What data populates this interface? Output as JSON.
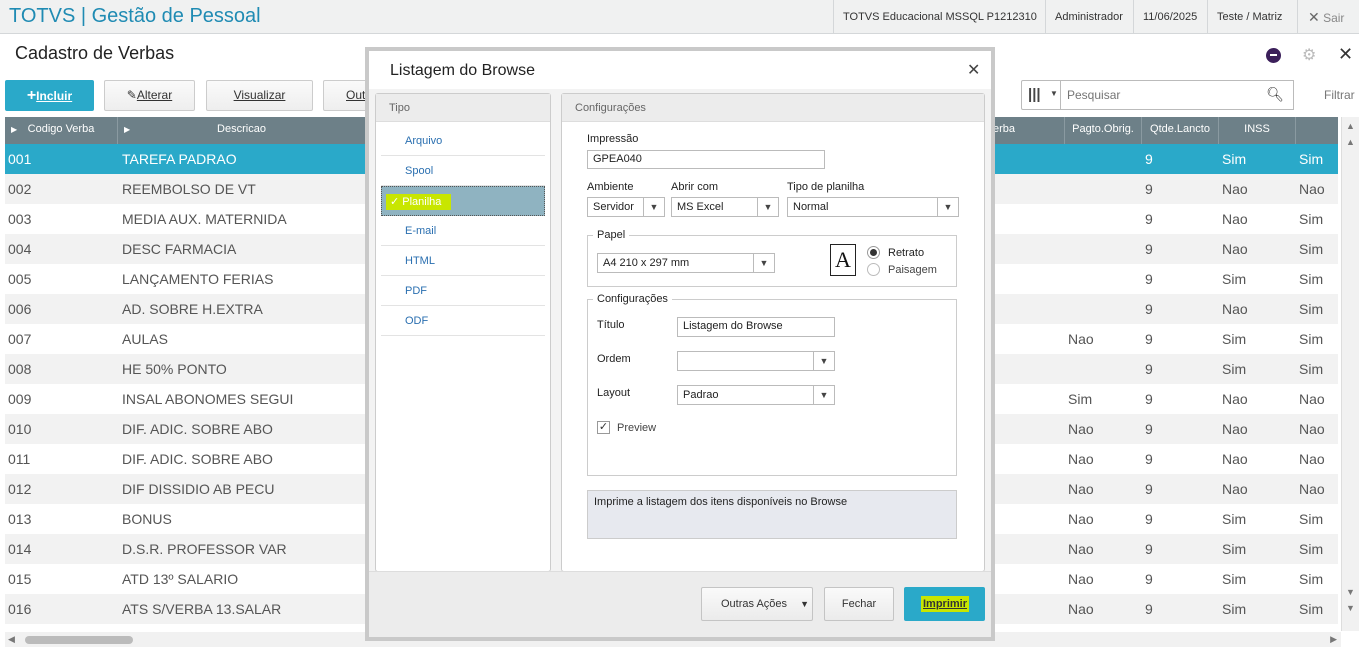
{
  "app": {
    "title": "TOTVS | Gestão de Pessoal"
  },
  "topbar": {
    "env": "TOTVS Educacional MSSQL P1212310",
    "user": "Administrador",
    "date": "11/06/2025",
    "branch": "Teste / Matriz",
    "exit_label": "Sair"
  },
  "page": {
    "title": "Cadastro de Verbas"
  },
  "toolbar": {
    "include": "Incluir",
    "edit": "Alterar",
    "view": "Visualizar",
    "other": "Out",
    "search_placeholder": "Pesquisar",
    "filter": "Filtrar"
  },
  "grid": {
    "columns": [
      "Codigo Verba",
      "Descricao",
      "erba",
      "Pagto.Obrig.",
      "Qtde.Lancto",
      "INSS"
    ],
    "rows": [
      {
        "code": "001",
        "desc": "TAREFA PADRAO",
        "pagto": "",
        "qtde": "9",
        "inss": "Sim",
        "last": "Sim"
      },
      {
        "code": "002",
        "desc": "REEMBOLSO DE VT",
        "pagto": "",
        "qtde": "9",
        "inss": "Nao",
        "last": "Nao"
      },
      {
        "code": "003",
        "desc": "MEDIA AUX. MATERNIDA",
        "pagto": "",
        "qtde": "9",
        "inss": "Nao",
        "last": "Sim"
      },
      {
        "code": "004",
        "desc": "DESC FARMACIA",
        "pagto": "",
        "qtde": "9",
        "inss": "Nao",
        "last": "Sim"
      },
      {
        "code": "005",
        "desc": "LANÇAMENTO FERIAS",
        "pagto": "",
        "qtde": "9",
        "inss": "Sim",
        "last": "Sim"
      },
      {
        "code": "006",
        "desc": "AD. SOBRE H.EXTRA",
        "pagto": "",
        "qtde": "9",
        "inss": "Nao",
        "last": "Sim"
      },
      {
        "code": "007",
        "desc": "AULAS",
        "pagto": "Nao",
        "qtde": "9",
        "inss": "Sim",
        "last": "Sim"
      },
      {
        "code": "008",
        "desc": "HE 50% PONTO",
        "pagto": "",
        "qtde": "9",
        "inss": "Sim",
        "last": "Sim"
      },
      {
        "code": "009",
        "desc": "INSAL ABONOMES SEGUI",
        "pagto": "Sim",
        "qtde": "9",
        "inss": "Nao",
        "last": "Nao"
      },
      {
        "code": "010",
        "desc": "DIF. ADIC. SOBRE ABO",
        "pagto": "Nao",
        "qtde": "9",
        "inss": "Nao",
        "last": "Nao"
      },
      {
        "code": "011",
        "desc": "DIF. ADIC. SOBRE ABO",
        "pagto": "Nao",
        "qtde": "9",
        "inss": "Nao",
        "last": "Nao"
      },
      {
        "code": "012",
        "desc": "DIF DISSIDIO AB PECU",
        "pagto": "Nao",
        "qtde": "9",
        "inss": "Nao",
        "last": "Nao"
      },
      {
        "code": "013",
        "desc": "BONUS",
        "pagto": "Nao",
        "qtde": "9",
        "inss": "Sim",
        "last": "Sim"
      },
      {
        "code": "014",
        "desc": "D.S.R. PROFESSOR VAR",
        "pagto": "Nao",
        "qtde": "9",
        "inss": "Sim",
        "last": "Sim"
      },
      {
        "code": "015",
        "desc": "ATD 13º SALARIO",
        "pagto": "Nao",
        "qtde": "9",
        "inss": "Sim",
        "last": "Sim"
      },
      {
        "code": "016",
        "desc": "ATS S/VERBA 13.SALAR",
        "pagto": "Nao",
        "qtde": "9",
        "inss": "Sim",
        "last": "Sim"
      }
    ]
  },
  "dialog": {
    "title": "Listagem do Browse",
    "tipo": {
      "header": "Tipo",
      "items": [
        "Arquivo",
        "Spool",
        "Planilha",
        "E-mail",
        "HTML",
        "PDF",
        "ODF"
      ],
      "selected": "Planilha"
    },
    "config": {
      "header": "Configurações",
      "impressao_label": "Impressão",
      "impressao_value": "GPEA040",
      "ambiente_label": "Ambiente",
      "ambiente_value": "Servidor",
      "abrir_label": "Abrir com",
      "abrir_value": "MS Excel",
      "tipo_planilha_label": "Tipo de planilha",
      "tipo_planilha_value": "Normal",
      "papel_legend": "Papel",
      "papel_value": "A4 210 x 297 mm",
      "retrato": "Retrato",
      "paisagem": "Paisagem",
      "config_legend": "Configurações",
      "titulo_label": "Título",
      "titulo_value": "Listagem do Browse",
      "ordem_label": "Ordem",
      "ordem_value": "",
      "layout_label": "Layout",
      "layout_value": "Padrao",
      "preview_label": "Preview",
      "description": "Imprime a listagem dos itens disponíveis no Browse"
    },
    "buttons": {
      "other_actions": "Outras Ações",
      "close": "Fechar",
      "print": "Imprimir"
    }
  },
  "colors": {
    "accent": "#2aa9c9",
    "header": "#6d8088",
    "highlight": "#c8e600"
  }
}
